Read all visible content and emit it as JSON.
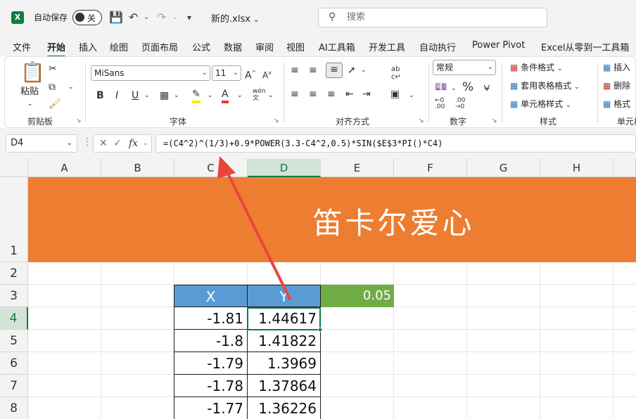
{
  "titlebar": {
    "logo_letter": "X",
    "autosave_label": "自动保存",
    "autosave_state": "关",
    "filename": "新的.xlsx",
    "search_placeholder": "搜索"
  },
  "menu": {
    "tabs": [
      {
        "label": "文件"
      },
      {
        "label": "开始"
      },
      {
        "label": "插入"
      },
      {
        "label": "绘图"
      },
      {
        "label": "页面布局"
      },
      {
        "label": "公式"
      },
      {
        "label": "数据"
      },
      {
        "label": "审阅"
      },
      {
        "label": "视图"
      },
      {
        "label": "AI工具箱"
      },
      {
        "label": "开发工具"
      },
      {
        "label": "自动执行"
      },
      {
        "label": "Power Pivot"
      },
      {
        "label": "Excel从零到一工具箱"
      }
    ],
    "active": "开始"
  },
  "ribbon": {
    "clipboard": {
      "label": "剪贴板",
      "paste": "粘贴"
    },
    "font": {
      "label": "字体",
      "name": "MiSans",
      "size": "11"
    },
    "alignment": {
      "label": "对齐方式"
    },
    "number": {
      "label": "数字",
      "format": "常规"
    },
    "styles": {
      "label": "样式",
      "conditional": "条件格式",
      "table": "套用表格格式",
      "cell_styles": "单元格样式"
    },
    "cells": {
      "label": "单元格",
      "insert": "插入",
      "delete": "删除",
      "format": "格式"
    }
  },
  "formula_bar": {
    "namebox": "D4",
    "fx": "fx",
    "formula": "=(C4^2)^(1/3)+0.9*POWER(3.3-C4^2,0.5)*SIN($E$3*PI()*C4)"
  },
  "grid": {
    "columns": [
      "A",
      "B",
      "C",
      "D",
      "E",
      "F",
      "G",
      "H"
    ],
    "selected_column": "D",
    "rows": [
      "1",
      "2",
      "3",
      "4",
      "5",
      "6",
      "7",
      "8"
    ],
    "selected_row": "4"
  },
  "sheet": {
    "banner_title": "笛卡尔爱心",
    "table_headers": [
      "X",
      "Y"
    ],
    "parameter": "0.05",
    "rows": [
      {
        "x": "-1.81",
        "y": "1.44617"
      },
      {
        "x": "-1.8",
        "y": "1.41822"
      },
      {
        "x": "-1.79",
        "y": "1.3969"
      },
      {
        "x": "-1.78",
        "y": "1.37864"
      },
      {
        "x": "-1.77",
        "y": "1.36226"
      }
    ]
  },
  "colors": {
    "excel_green": "#107c41",
    "banner_orange": "#ed7d31",
    "header_blue": "#5b9bd5",
    "param_green": "#70ad47",
    "arrow_red": "#e8453c"
  }
}
